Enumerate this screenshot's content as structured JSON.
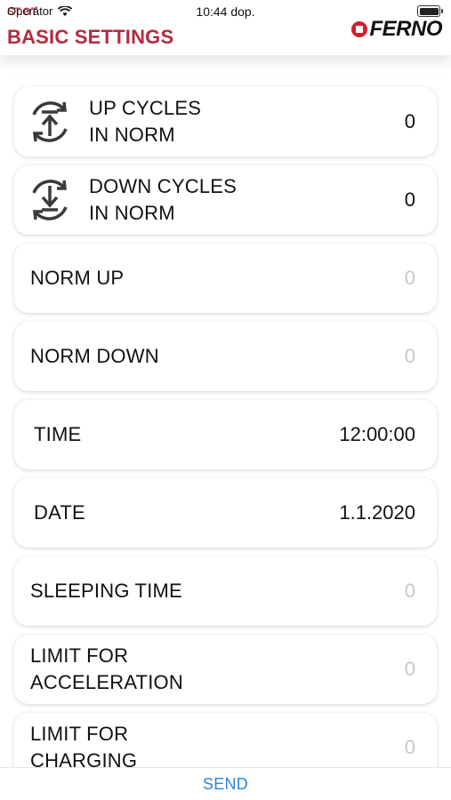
{
  "status_bar": {
    "carrier": "Operátor",
    "time": "10:44 dop.",
    "overlay_text": "ST.OT"
  },
  "header": {
    "title": "BASIC SETTINGS",
    "logo_text": "FERNO"
  },
  "settings": [
    {
      "label": "UP CYCLES\nIN NORM",
      "value": "0",
      "icon": "up-cycle-icon",
      "muted": false
    },
    {
      "label": "DOWN CYCLES\nIN NORM",
      "value": "0",
      "icon": "down-cycle-icon",
      "muted": false
    },
    {
      "label": "NORM UP",
      "value": "0",
      "muted": true
    },
    {
      "label": "NORM DOWN",
      "value": "0",
      "muted": true
    },
    {
      "label": "TIME",
      "value": "12:00:00",
      "muted": false
    },
    {
      "label": "DATE",
      "value": "1.1.2020",
      "muted": false
    },
    {
      "label": "SLEEPING TIME",
      "value": "0",
      "muted": true
    },
    {
      "label": "LIMIT FOR\nACCELERATION",
      "value": "0",
      "muted": true
    },
    {
      "label": "LIMIT FOR\nCHARGING",
      "value": "0",
      "muted": true
    }
  ],
  "footer": {
    "send_label": "SEND"
  },
  "colors": {
    "title": "#b52a3c",
    "accent": "#2f86d9",
    "logo_red": "#d11f2e"
  }
}
